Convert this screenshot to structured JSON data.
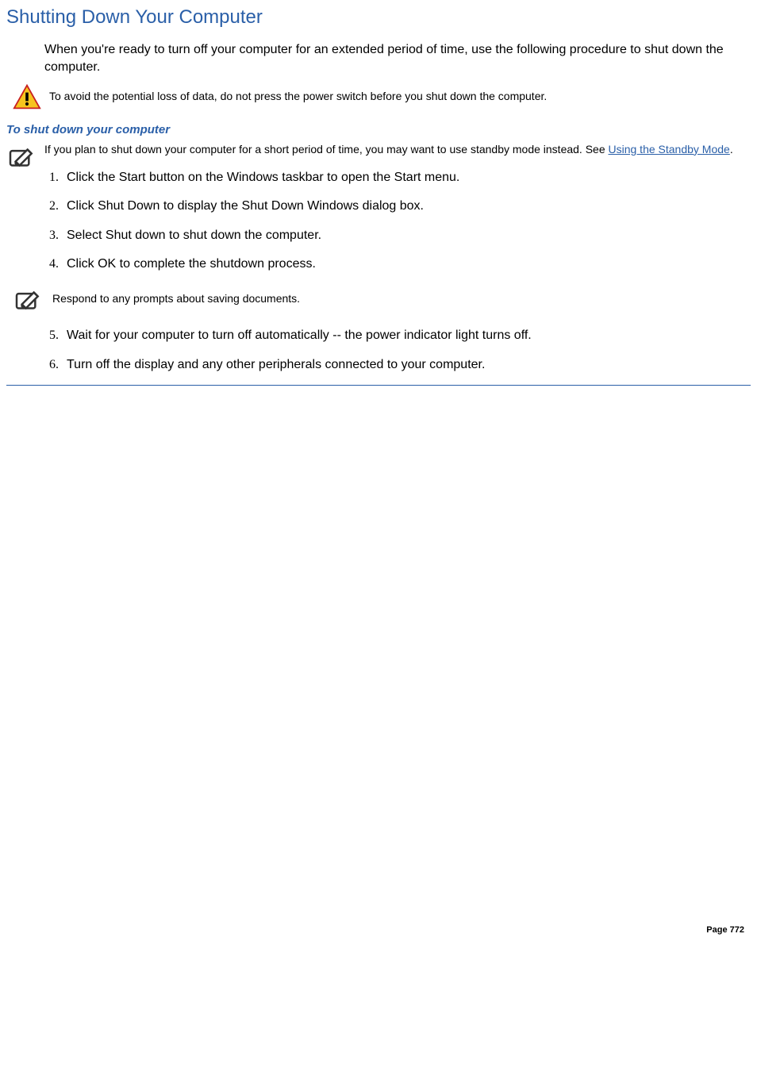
{
  "heading": "Shutting Down Your Computer",
  "intro": "When you're ready to turn off your computer for an extended period of time, use the following procedure to shut down the computer.",
  "warning_note": "To avoid the potential loss of data, do not press the power switch before you shut down the computer.",
  "subheading": "To shut down your computer",
  "standby_note_pre": " If you plan to shut down your computer for a short period of time, you may want to use standby mode instead. See ",
  "standby_link_text": "Using the Standby Mode",
  "standby_note_post": ".",
  "steps_a": [
    "Click the Start button on the Windows taskbar to open the Start menu.",
    "Click Shut Down to display the Shut Down Windows dialog box.",
    "Select Shut down to shut down the computer.",
    "Click OK to complete the shutdown process."
  ],
  "mid_note": "Respond to any prompts about saving documents.",
  "steps_b": [
    "Wait for your computer to turn off automatically -- the power indicator light turns off.",
    "Turn off the display and any other peripherals connected to your computer."
  ],
  "page_label": "Page 772"
}
